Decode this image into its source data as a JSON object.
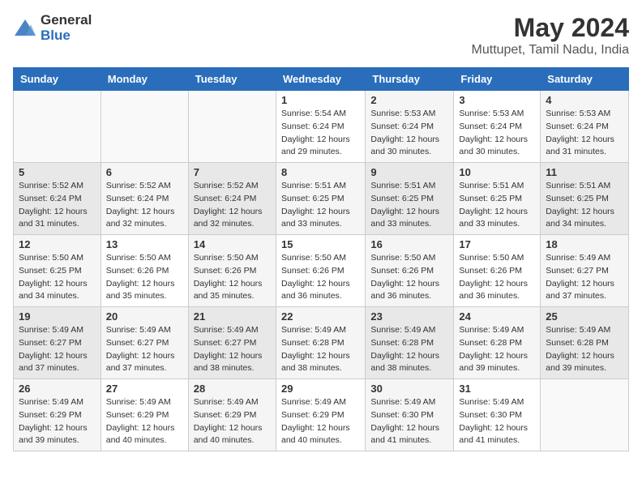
{
  "header": {
    "logo": {
      "general": "General",
      "blue": "Blue"
    },
    "title": "May 2024",
    "location": "Muttupet, Tamil Nadu, India"
  },
  "calendar": {
    "days_of_week": [
      "Sunday",
      "Monday",
      "Tuesday",
      "Wednesday",
      "Thursday",
      "Friday",
      "Saturday"
    ],
    "weeks": [
      [
        {
          "day": "",
          "info": ""
        },
        {
          "day": "",
          "info": ""
        },
        {
          "day": "",
          "info": ""
        },
        {
          "day": "1",
          "info": "Sunrise: 5:54 AM\nSunset: 6:24 PM\nDaylight: 12 hours\nand 29 minutes."
        },
        {
          "day": "2",
          "info": "Sunrise: 5:53 AM\nSunset: 6:24 PM\nDaylight: 12 hours\nand 30 minutes."
        },
        {
          "day": "3",
          "info": "Sunrise: 5:53 AM\nSunset: 6:24 PM\nDaylight: 12 hours\nand 30 minutes."
        },
        {
          "day": "4",
          "info": "Sunrise: 5:53 AM\nSunset: 6:24 PM\nDaylight: 12 hours\nand 31 minutes."
        }
      ],
      [
        {
          "day": "5",
          "info": "Sunrise: 5:52 AM\nSunset: 6:24 PM\nDaylight: 12 hours\nand 31 minutes."
        },
        {
          "day": "6",
          "info": "Sunrise: 5:52 AM\nSunset: 6:24 PM\nDaylight: 12 hours\nand 32 minutes."
        },
        {
          "day": "7",
          "info": "Sunrise: 5:52 AM\nSunset: 6:24 PM\nDaylight: 12 hours\nand 32 minutes."
        },
        {
          "day": "8",
          "info": "Sunrise: 5:51 AM\nSunset: 6:25 PM\nDaylight: 12 hours\nand 33 minutes."
        },
        {
          "day": "9",
          "info": "Sunrise: 5:51 AM\nSunset: 6:25 PM\nDaylight: 12 hours\nand 33 minutes."
        },
        {
          "day": "10",
          "info": "Sunrise: 5:51 AM\nSunset: 6:25 PM\nDaylight: 12 hours\nand 33 minutes."
        },
        {
          "day": "11",
          "info": "Sunrise: 5:51 AM\nSunset: 6:25 PM\nDaylight: 12 hours\nand 34 minutes."
        }
      ],
      [
        {
          "day": "12",
          "info": "Sunrise: 5:50 AM\nSunset: 6:25 PM\nDaylight: 12 hours\nand 34 minutes."
        },
        {
          "day": "13",
          "info": "Sunrise: 5:50 AM\nSunset: 6:26 PM\nDaylight: 12 hours\nand 35 minutes."
        },
        {
          "day": "14",
          "info": "Sunrise: 5:50 AM\nSunset: 6:26 PM\nDaylight: 12 hours\nand 35 minutes."
        },
        {
          "day": "15",
          "info": "Sunrise: 5:50 AM\nSunset: 6:26 PM\nDaylight: 12 hours\nand 36 minutes."
        },
        {
          "day": "16",
          "info": "Sunrise: 5:50 AM\nSunset: 6:26 PM\nDaylight: 12 hours\nand 36 minutes."
        },
        {
          "day": "17",
          "info": "Sunrise: 5:50 AM\nSunset: 6:26 PM\nDaylight: 12 hours\nand 36 minutes."
        },
        {
          "day": "18",
          "info": "Sunrise: 5:49 AM\nSunset: 6:27 PM\nDaylight: 12 hours\nand 37 minutes."
        }
      ],
      [
        {
          "day": "19",
          "info": "Sunrise: 5:49 AM\nSunset: 6:27 PM\nDaylight: 12 hours\nand 37 minutes."
        },
        {
          "day": "20",
          "info": "Sunrise: 5:49 AM\nSunset: 6:27 PM\nDaylight: 12 hours\nand 37 minutes."
        },
        {
          "day": "21",
          "info": "Sunrise: 5:49 AM\nSunset: 6:27 PM\nDaylight: 12 hours\nand 38 minutes."
        },
        {
          "day": "22",
          "info": "Sunrise: 5:49 AM\nSunset: 6:28 PM\nDaylight: 12 hours\nand 38 minutes."
        },
        {
          "day": "23",
          "info": "Sunrise: 5:49 AM\nSunset: 6:28 PM\nDaylight: 12 hours\nand 38 minutes."
        },
        {
          "day": "24",
          "info": "Sunrise: 5:49 AM\nSunset: 6:28 PM\nDaylight: 12 hours\nand 39 minutes."
        },
        {
          "day": "25",
          "info": "Sunrise: 5:49 AM\nSunset: 6:28 PM\nDaylight: 12 hours\nand 39 minutes."
        }
      ],
      [
        {
          "day": "26",
          "info": "Sunrise: 5:49 AM\nSunset: 6:29 PM\nDaylight: 12 hours\nand 39 minutes."
        },
        {
          "day": "27",
          "info": "Sunrise: 5:49 AM\nSunset: 6:29 PM\nDaylight: 12 hours\nand 40 minutes."
        },
        {
          "day": "28",
          "info": "Sunrise: 5:49 AM\nSunset: 6:29 PM\nDaylight: 12 hours\nand 40 minutes."
        },
        {
          "day": "29",
          "info": "Sunrise: 5:49 AM\nSunset: 6:29 PM\nDaylight: 12 hours\nand 40 minutes."
        },
        {
          "day": "30",
          "info": "Sunrise: 5:49 AM\nSunset: 6:30 PM\nDaylight: 12 hours\nand 41 minutes."
        },
        {
          "day": "31",
          "info": "Sunrise: 5:49 AM\nSunset: 6:30 PM\nDaylight: 12 hours\nand 41 minutes."
        },
        {
          "day": "",
          "info": ""
        }
      ]
    ]
  }
}
